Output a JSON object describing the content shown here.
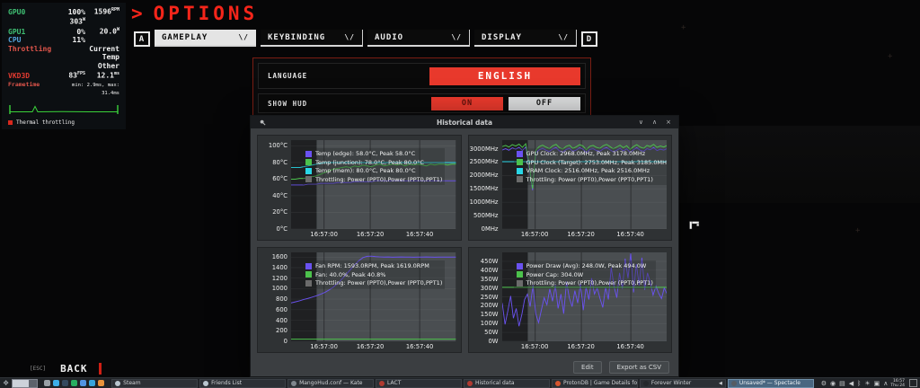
{
  "hud": {
    "gpu0_label": "GPU0",
    "gpu0_load": "100%",
    "gpu0_fan": "1596",
    "gpu0_fan_unit": "RPM",
    "gpu0_power": "303",
    "gpu0_power_unit": "W",
    "gpu1_label": "GPU1",
    "gpu1_load": "0%",
    "gpu1_power": "20.0",
    "gpu1_power_unit": "W",
    "cpu_label": "CPU",
    "cpu_load": "11%",
    "throttling_label": "Throttling",
    "throttling_lines": [
      "Current",
      "Temp",
      "Other"
    ],
    "vkd3d_label": "VKD3D",
    "vkd3d_fps": "83",
    "vkd3d_fps_unit": "FPS",
    "vkd3d_ms": "12.1",
    "vkd3d_ms_unit": "ms",
    "frametime_label": "Frametime",
    "frametime_minmax": "min: 2.9ms, max: 31.4ms",
    "legend_label": "Thermal throttling"
  },
  "game": {
    "title_chevron": ">",
    "title": "OPTIONS",
    "left_key": "A",
    "right_key": "D",
    "tab_dropdown_glyph": "\\/",
    "tabs": [
      {
        "label": "GAMEPLAY",
        "selected": true
      },
      {
        "label": "KEYBINDING",
        "selected": false
      },
      {
        "label": "AUDIO",
        "selected": false
      },
      {
        "label": "DISPLAY",
        "selected": false
      }
    ],
    "settings": {
      "language_label": "LANGUAGE",
      "language_value": "ENGLISH",
      "show_hud_label": "SHOW HUD",
      "on_label": "ON",
      "off_label": "OFF"
    },
    "footer": {
      "esc_key": "[ESC]",
      "back_label": "BACK"
    }
  },
  "window": {
    "title": "Historical data",
    "minimize_glyph": "∨",
    "maximize_glyph": "∧",
    "close_glyph": "×",
    "edit_label": "Edit",
    "export_label": "Export as CSV"
  },
  "chart_data": [
    {
      "type": "line",
      "ylim": [
        0,
        107
      ],
      "ytick_values": [
        0,
        20,
        40,
        60,
        80,
        100
      ],
      "ytick_labels": [
        "0°C",
        "20°C",
        "40°C",
        "60°C",
        "80°C",
        "100°C"
      ],
      "xticks": [
        {
          "pos": 0.2,
          "label": "16:57:00"
        },
        {
          "pos": 0.48,
          "label": "16:57:20"
        },
        {
          "pos": 0.78,
          "label": "16:57:40"
        }
      ],
      "throttle_regions": [
        [
          0.155,
          1.0
        ]
      ],
      "series": [
        {
          "name": "Temp (edge)",
          "color": "#6a52f0",
          "values": [
            53,
            53,
            53,
            53,
            54,
            54,
            54,
            55,
            55,
            55,
            55,
            56,
            56,
            56,
            56,
            57,
            57,
            57,
            57,
            57,
            58,
            58,
            58,
            58,
            58,
            58,
            58,
            58,
            58,
            58,
            58,
            58,
            58,
            58,
            58,
            58,
            58,
            58,
            58,
            58
          ]
        },
        {
          "name": "Temp (junction)",
          "color": "#4cc24c",
          "values": [
            60,
            60,
            61,
            61,
            62,
            63,
            64,
            66,
            68,
            70,
            72,
            73,
            74,
            75,
            74,
            76,
            75,
            77,
            76,
            75,
            77,
            78,
            76,
            77,
            78,
            77,
            78,
            76,
            78,
            77,
            78,
            77,
            76,
            78,
            77,
            78,
            78,
            77,
            78,
            78
          ]
        },
        {
          "name": "Temp (mem)",
          "color": "#29d6e6",
          "values": [
            74,
            74,
            74,
            75,
            76,
            77,
            78,
            79,
            80,
            80,
            80,
            80,
            80,
            80,
            80,
            80,
            80,
            80,
            80,
            80,
            80,
            80,
            80,
            80,
            80,
            80,
            80,
            80,
            80,
            80,
            80,
            80,
            80,
            80,
            80,
            80,
            80,
            80,
            80,
            80
          ]
        }
      ],
      "legend": [
        {
          "color": "#6a52f0",
          "label": "Temp (edge): 58.0°C, Peak 58.0°C"
        },
        {
          "color": "#4cc24c",
          "label": "Temp (junction): 78.0°C, Peak 80.0°C"
        },
        {
          "color": "#29d6e6",
          "label": "Temp (mem): 80.0°C, Peak 80.0°C"
        },
        {
          "color": "#6b6b6b",
          "label": "Throttling: Power (PPT0),Power (PPT0,PPT1)"
        }
      ]
    },
    {
      "type": "line",
      "ylim": [
        0,
        3320
      ],
      "ytick_values": [
        0,
        500,
        1000,
        1500,
        2000,
        2500,
        3000
      ],
      "ytick_labels": [
        "0MHz",
        "500MHz",
        "1000MHz",
        "1500MHz",
        "2000MHz",
        "2500MHz",
        "3000MHz"
      ],
      "xticks": [
        {
          "pos": 0.2,
          "label": "16:57:00"
        },
        {
          "pos": 0.48,
          "label": "16:57:20"
        },
        {
          "pos": 0.78,
          "label": "16:57:40"
        }
      ],
      "throttle_regions": [
        [
          0.155,
          1.0
        ]
      ],
      "series": [
        {
          "name": "GPU Clock",
          "color": "#6a52f0",
          "values": [
            2950,
            3000,
            2940,
            3030,
            2980,
            3050,
            2930,
            3060,
            2300,
            1450,
            2850,
            2960,
            3010,
            2940,
            2890,
            2990,
            3040,
            2920,
            2870,
            2970,
            3010,
            2900,
            2950,
            3030,
            2980,
            2850,
            2970,
            3000,
            2930,
            2900,
            2990,
            3040,
            2960,
            2880,
            2940,
            3010,
            2920,
            2990,
            2860,
            2960,
            3030,
            2940,
            2900,
            3000,
            2960,
            3040,
            2930,
            2980,
            2950,
            3000
          ]
        },
        {
          "name": "GPU Clock (Target)",
          "color": "#4cc24c",
          "values": [
            3080,
            3120,
            3060,
            3150,
            3100,
            3170,
            3050,
            3185,
            2400,
            1500,
            2950,
            3080,
            3130,
            3060,
            3000,
            3110,
            3160,
            3040,
            2980,
            3090,
            3130,
            3010,
            3070,
            3150,
            3100,
            2960,
            3090,
            3120,
            3050,
            3010,
            3110,
            3160,
            3080,
            2990,
            3060,
            3130,
            3040,
            3110,
            2970,
            3080,
            3150,
            3060,
            3010,
            3120,
            3080,
            3160,
            3050,
            3100,
            3060,
            3120
          ]
        },
        {
          "name": "VRAM Clock",
          "color": "#29d6e6",
          "values": [
            2516,
            2516
          ]
        }
      ],
      "legend": [
        {
          "color": "#6a52f0",
          "label": "GPU Clock: 2968.0MHz, Peak 3178.0MHz"
        },
        {
          "color": "#4cc24c",
          "label": "GPU Clock (Target): 2753.0MHz, Peak 3185.0MHz"
        },
        {
          "color": "#29d6e6",
          "label": "VRAM Clock: 2516.0MHz, Peak 2516.0MHz"
        },
        {
          "color": "#6b6b6b",
          "label": "Throttling: Power (PPT0),Power (PPT0,PPT1)"
        }
      ]
    },
    {
      "type": "line",
      "ylim": [
        0,
        1690
      ],
      "ytick_values": [
        0,
        200,
        400,
        600,
        800,
        1000,
        1200,
        1400,
        1600
      ],
      "ytick_labels": [
        "0",
        "200",
        "400",
        "600",
        "800",
        "1000",
        "1200",
        "1400",
        "1600"
      ],
      "xticks": [
        {
          "pos": 0.2,
          "label": "16:57:00"
        },
        {
          "pos": 0.48,
          "label": "16:57:20"
        },
        {
          "pos": 0.78,
          "label": "16:57:40"
        }
      ],
      "throttle_regions": [
        [
          0.155,
          1.0
        ]
      ],
      "series": [
        {
          "name": "Fan RPM",
          "color": "#6a52f0",
          "values": [
            730,
            750,
            770,
            795,
            815,
            840,
            865,
            895,
            930,
            975,
            1030,
            1100,
            1180,
            1270,
            1360,
            1450,
            1530,
            1590,
            1615,
            1619,
            1610,
            1604,
            1600,
            1602,
            1599,
            1600,
            1601,
            1600,
            1600,
            1599,
            1600,
            1600,
            1601,
            1600,
            1599,
            1600,
            1600,
            1600,
            1600,
            1600
          ]
        },
        {
          "name": "Fan",
          "color": "#4cc24c",
          "values": [
            40,
            40
          ]
        }
      ],
      "legend": [
        {
          "color": "#6a52f0",
          "label": "Fan RPM: 1593.0RPM, Peak 1619.0RPM"
        },
        {
          "color": "#4cc24c",
          "label": "Fan: 40.0%, Peak 40.8%"
        },
        {
          "color": "#6b6b6b",
          "label": "Throttling: Power (PPT0),Power (PPT0,PPT1)"
        }
      ]
    },
    {
      "type": "line",
      "ylim": [
        0,
        500
      ],
      "ytick_values": [
        0,
        50,
        100,
        150,
        200,
        250,
        300,
        350,
        400,
        450
      ],
      "ytick_labels": [
        "0W",
        "50W",
        "100W",
        "150W",
        "200W",
        "250W",
        "300W",
        "350W",
        "400W",
        "450W"
      ],
      "xticks": [
        {
          "pos": 0.2,
          "label": "16:57:00"
        },
        {
          "pos": 0.48,
          "label": "16:57:20"
        },
        {
          "pos": 0.78,
          "label": "16:57:40"
        }
      ],
      "throttle_regions": [
        [
          0.155,
          1.0
        ]
      ],
      "series": [
        {
          "name": "Power Draw (Avg)",
          "color": "#6a52f0",
          "values": [
            215,
            95,
            170,
            255,
            130,
            185,
            85,
            150,
            235,
            265,
            195,
            315,
            155,
            105,
            175,
            245,
            205,
            295,
            225,
            315,
            185,
            265,
            155,
            335,
            245,
            195,
            285,
            215,
            325,
            175,
            305,
            235,
            355,
            265,
            300,
            240,
            190,
            305,
            235,
            415,
            310,
            245,
            385,
            295,
            465,
            355,
            494,
            275,
            435,
            315,
            470,
            290,
            385,
            330,
            260,
            310,
            270,
            240,
            300,
            265
          ]
        },
        {
          "name": "Power Cap",
          "color": "#4cc24c",
          "values": [
            304,
            304
          ]
        }
      ],
      "legend": [
        {
          "color": "#6a52f0",
          "label": "Power Draw (Avg): 248.0W, Peak 494.0W"
        },
        {
          "color": "#4cc24c",
          "label": "Power Cap: 304.0W"
        },
        {
          "color": "#6b6b6b",
          "label": "Throttling: Power (PPT0),Power (PPT0,PPT1)"
        }
      ]
    }
  ],
  "taskbar": {
    "quick_icons": [
      {
        "name": "cursor-tool-icon",
        "color": "#9aa0a6"
      },
      {
        "name": "file-manager-icon",
        "color": "#3daee9"
      },
      {
        "name": "package-icon",
        "color": "#34495e"
      },
      {
        "name": "system-monitor-icon",
        "color": "#27ae60"
      },
      {
        "name": "browser-icon",
        "color": "#5294e2"
      },
      {
        "name": "telegram-icon",
        "color": "#37a5dc"
      },
      {
        "name": "firefox-icon",
        "color": "#e8923a"
      }
    ],
    "tasks": [
      {
        "label": "Steam",
        "icon_color": "#b9c6cf",
        "active": false,
        "audio": false
      },
      {
        "label": "Friends List",
        "icon_color": "#b9c6cf",
        "active": false,
        "audio": false
      },
      {
        "label": "MangoHud.conf — Kate",
        "icon_color": "#7f868d",
        "active": false,
        "audio": false
      },
      {
        "label": "LACT",
        "icon_color": "#b03a30",
        "active": false,
        "audio": false
      },
      {
        "label": "Historical data",
        "icon_color": "#b03a30",
        "active": false,
        "audio": false
      },
      {
        "label": "ProtonDB | Game Details for Th…",
        "icon_color": "#d6552f",
        "active": false,
        "audio": false
      },
      {
        "label": "Forever Winter",
        "icon_color": "#24282c",
        "active": false,
        "audio": true
      },
      {
        "label": "Unsaved* — Spectacle",
        "icon_color": "#555c63",
        "active": true,
        "audio": false
      }
    ],
    "tray_icons": [
      {
        "name": "updates-tray-icon",
        "glyph": "⚙"
      },
      {
        "name": "steam-tray-icon",
        "glyph": "◉"
      },
      {
        "name": "clipboard-tray-icon",
        "glyph": "▤"
      },
      {
        "name": "volume-tray-icon",
        "glyph": "◀"
      },
      {
        "name": "bluetooth-tray-icon",
        "glyph": "ᛒ"
      },
      {
        "name": "brightness-tray-icon",
        "glyph": "☀"
      },
      {
        "name": "display-tray-icon",
        "glyph": "▣"
      },
      {
        "name": "tray-expander-icon",
        "glyph": "∧"
      }
    ],
    "clock_time": "16:57",
    "clock_date": "Thu 24"
  },
  "colors": {
    "accent_red": "#e8392c",
    "series_purple": "#6a52f0",
    "series_green": "#4cc24c",
    "series_cyan": "#29d6e6",
    "throttle_band": "#4a4e51"
  }
}
